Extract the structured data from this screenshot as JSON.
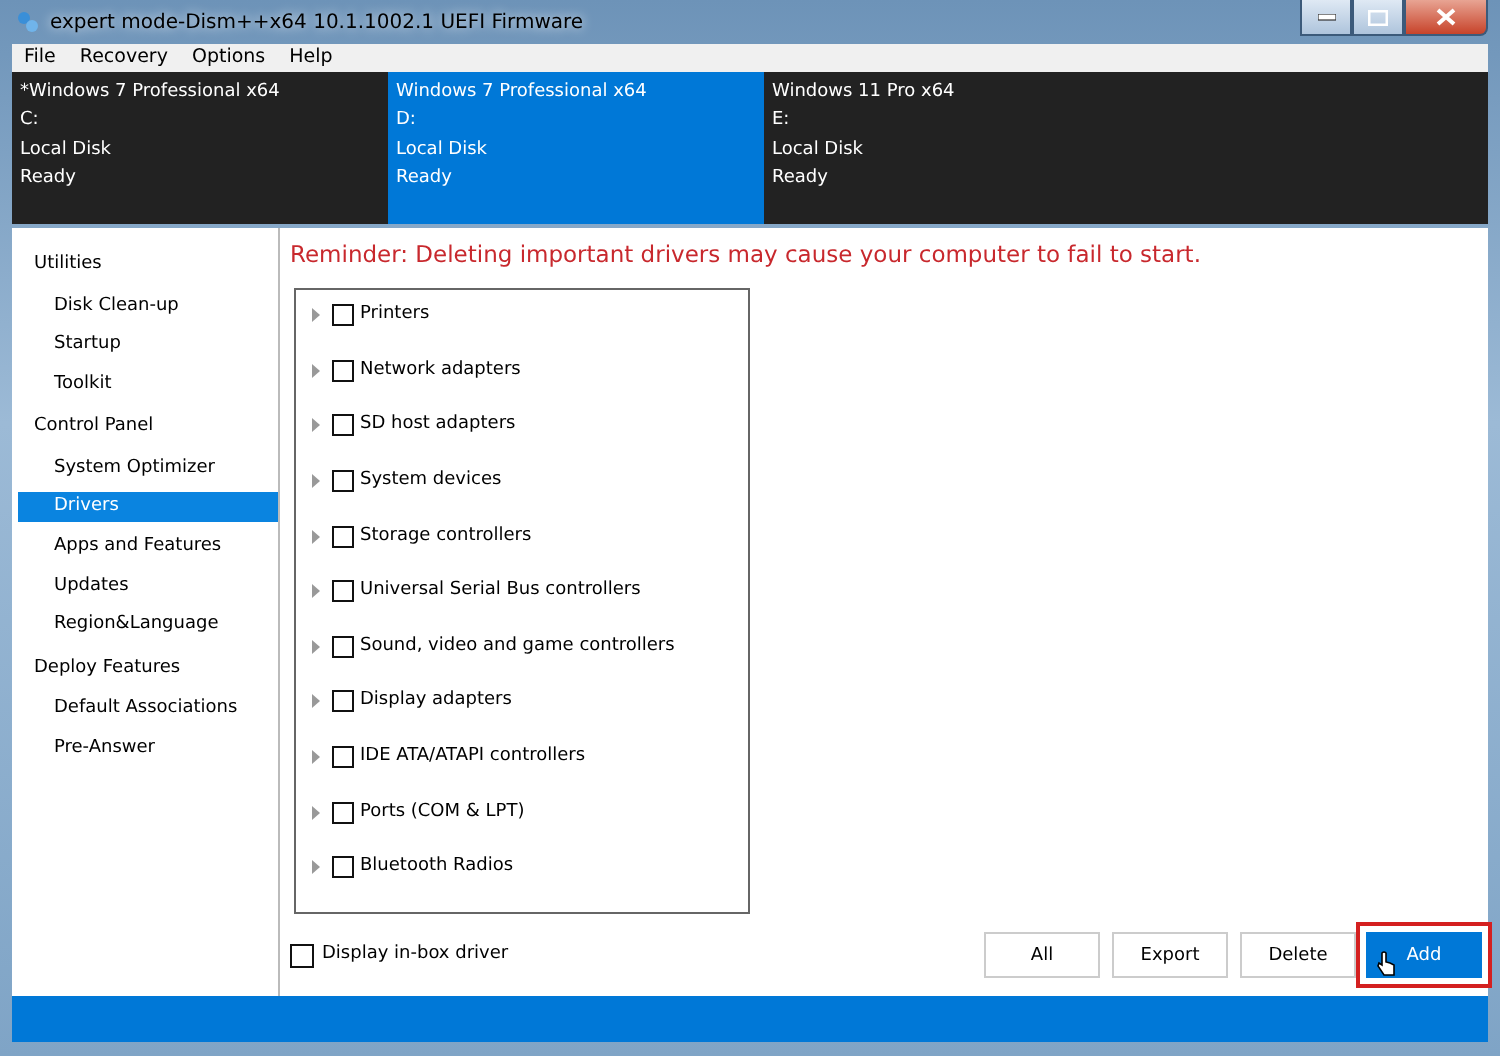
{
  "window": {
    "title": "expert mode-Dism++x64 10.1.1002.1 UEFI Firmware"
  },
  "menu": [
    "File",
    "Recovery",
    "Options",
    "Help"
  ],
  "images": [
    {
      "name": "*Windows 7 Professional x64",
      "drive": "C:",
      "disk": "Local Disk",
      "status": "Ready",
      "selected": false
    },
    {
      "name": "Windows 7 Professional x64",
      "drive": "D:",
      "disk": "Local Disk",
      "status": "Ready",
      "selected": true
    },
    {
      "name": "Windows 11 Pro x64",
      "drive": "E:",
      "disk": "Local Disk",
      "status": "Ready",
      "selected": false
    }
  ],
  "sidebar": {
    "groups": [
      {
        "label": "Utilities",
        "items": [
          {
            "label": "Disk Clean-up",
            "selected": false
          },
          {
            "label": "Startup",
            "selected": false
          },
          {
            "label": "Toolkit",
            "selected": false
          }
        ]
      },
      {
        "label": "Control Panel",
        "items": [
          {
            "label": "System Optimizer",
            "selected": false
          },
          {
            "label": "Drivers",
            "selected": true
          },
          {
            "label": "Apps and Features",
            "selected": false
          },
          {
            "label": "Updates",
            "selected": false
          },
          {
            "label": "Region&Language",
            "selected": false
          }
        ]
      },
      {
        "label": "Deploy Features",
        "items": [
          {
            "label": "Default Associations",
            "selected": false
          },
          {
            "label": "Pre-Answer",
            "selected": false
          }
        ]
      }
    ]
  },
  "reminder": "Reminder: Deleting important drivers may cause your computer to fail to start.",
  "drivers": [
    {
      "label": "Printers",
      "checked": false
    },
    {
      "label": "Network adapters",
      "checked": false
    },
    {
      "label": "SD host adapters",
      "checked": false
    },
    {
      "label": "System devices",
      "checked": false
    },
    {
      "label": "Storage controllers",
      "checked": false
    },
    {
      "label": "Universal Serial Bus controllers",
      "checked": false
    },
    {
      "label": "Sound, video and game controllers",
      "checked": false
    },
    {
      "label": "Display adapters",
      "checked": false
    },
    {
      "label": "IDE ATA/ATAPI controllers",
      "checked": false
    },
    {
      "label": "Ports (COM & LPT)",
      "checked": false
    },
    {
      "label": "Bluetooth Radios",
      "checked": false
    }
  ],
  "display_inbox": {
    "label": "Display in-box driver",
    "checked": false
  },
  "buttons": [
    {
      "label": "All",
      "primary": false,
      "highlighted": false
    },
    {
      "label": "Export",
      "primary": false,
      "highlighted": false
    },
    {
      "label": "Delete",
      "primary": false,
      "highlighted": false
    },
    {
      "label": "Add",
      "primary": true,
      "highlighted": true
    }
  ]
}
